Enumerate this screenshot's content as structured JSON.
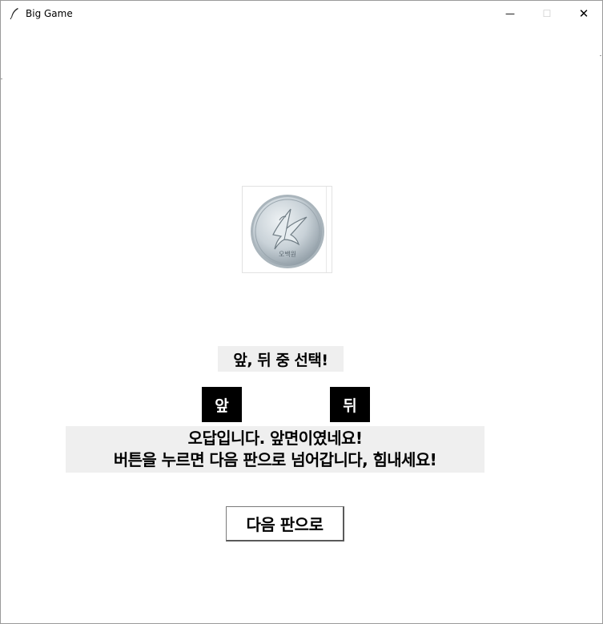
{
  "window": {
    "title": "Big Game",
    "app_icon": "feather-icon",
    "controls": {
      "minimize": "—",
      "maximize": "☐",
      "close": "✕"
    }
  },
  "coin": {
    "image": "coin-icon",
    "face": "front",
    "engraving": "오백원"
  },
  "prompt": "앞, 뒤 중 선택!",
  "buttons": {
    "front": "앞",
    "back": "뒤",
    "next": "다음 판으로"
  },
  "result": {
    "line1": "오답입니다. 앞면이였네요!",
    "line2": "버튼을 누르면 다음 판으로 넘어갑니다, 힘내세요!"
  },
  "colors": {
    "choice_button_bg": "#000000",
    "choice_button_text": "#ffffff",
    "label_bg": "#efefef",
    "coin_silver": "#c9d2d8"
  }
}
